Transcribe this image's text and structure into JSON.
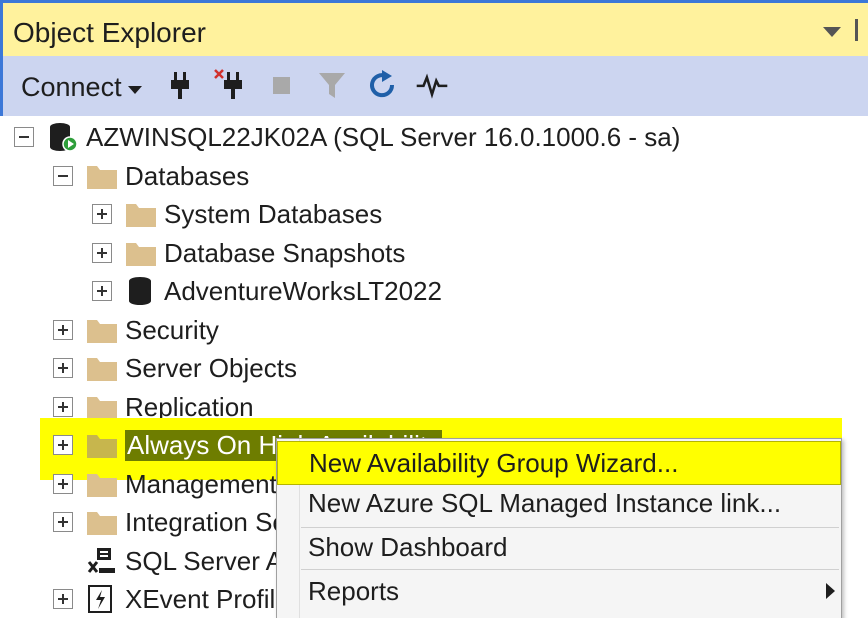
{
  "panel": {
    "title": "Object Explorer"
  },
  "toolbar": {
    "connect_label": "Connect",
    "icons": [
      "connect-plug-icon",
      "disconnect-plug-icon",
      "stop-icon",
      "filter-icon",
      "refresh-icon",
      "activity-monitor-icon"
    ]
  },
  "tree": {
    "server": "AZWINSQL22JK02A (SQL Server 16.0.1000.6 - sa)",
    "databases": "Databases",
    "system_databases": "System Databases",
    "database_snapshots": "Database Snapshots",
    "adventureworks": "AdventureWorksLT2022",
    "security": "Security",
    "server_objects": "Server Objects",
    "replication": "Replication",
    "always_on": "Always On High Availability",
    "management": "Management",
    "integration": "Integration Services Catalogs",
    "sql_agent": "SQL Server Agent",
    "xevent": "XEvent Profiler"
  },
  "context_menu": {
    "items": [
      "New Availability Group Wizard...",
      "New Azure SQL Managed Instance link...",
      "Show Dashboard",
      "Reports"
    ]
  },
  "colors": {
    "highlight": "#ffff00",
    "toolbar_bg": "#ccd5f0",
    "title_bg": "#fff29d",
    "folder": "#dcc08e"
  }
}
